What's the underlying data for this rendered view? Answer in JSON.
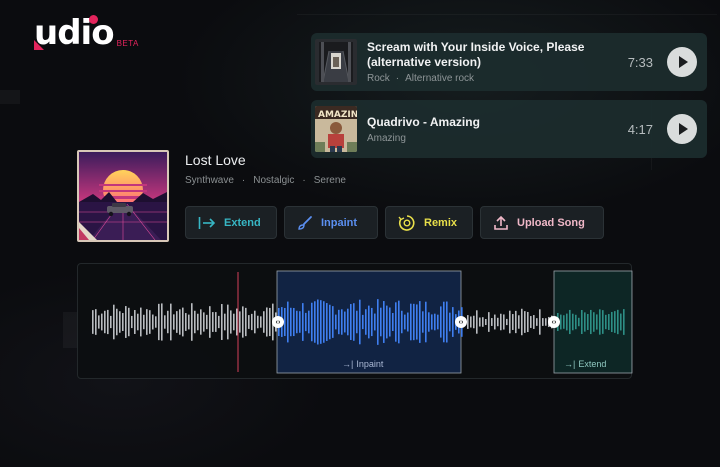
{
  "logo": {
    "wordmark": "udio",
    "badge": "BETA",
    "brand_color": "#e3245c"
  },
  "songs": [
    {
      "title_line1": "Scream with Your Inside Voice, Please",
      "title_line2": "(alternative version)",
      "tag1": "Rock",
      "tag2": "Alternative rock",
      "duration": "7:33"
    },
    {
      "title_line1": "Quadrivo - Amazing",
      "title_line2": "",
      "tag1": "Amazing",
      "tag2": "",
      "duration": "4:17"
    }
  ],
  "track": {
    "title": "Lost Love",
    "tags": [
      "Synthwave",
      "Nostalgic",
      "Serene"
    ]
  },
  "actions": {
    "extend": {
      "label": "Extend",
      "color": "#37b6c4"
    },
    "inpaint": {
      "label": "Inpaint",
      "color": "#5b8ff0"
    },
    "remix": {
      "label": "Remix",
      "color": "#e8df4a"
    },
    "upload": {
      "label": "Upload Song",
      "color": "#f0b8c8"
    }
  },
  "waveform": {
    "inpaint_label": "Inpaint",
    "extend_label": "Extend",
    "inpaint_color": "#3f7ef0",
    "extend_color": "#2e8f86",
    "playhead_color": "#d3405a"
  }
}
